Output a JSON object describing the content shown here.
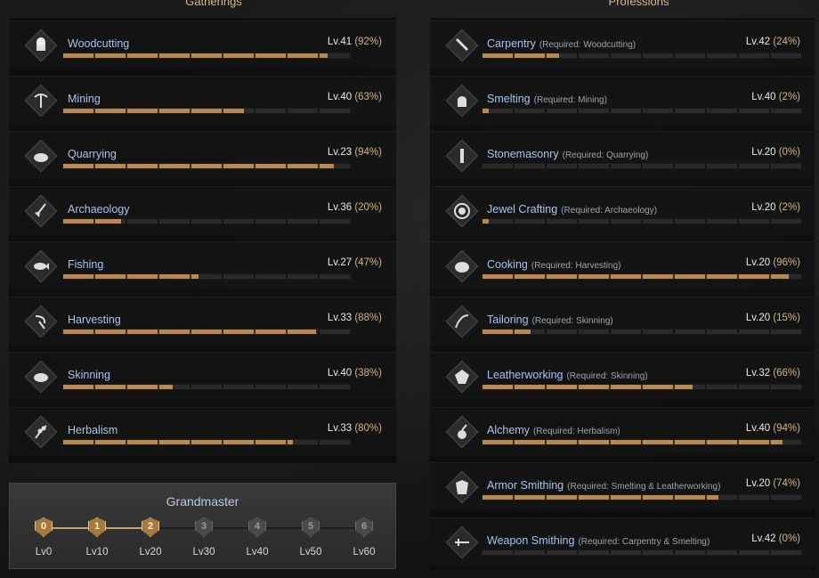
{
  "sections": {
    "gatherings_title": "Gatherings",
    "professions_title": "Professions"
  },
  "gatherings": [
    {
      "name": "Woodcutting",
      "level": "Lv.41",
      "percent": "(92%)",
      "progress": 0.92,
      "icon": "log-icon"
    },
    {
      "name": "Mining",
      "level": "Lv.40",
      "percent": "(63%)",
      "progress": 0.63,
      "icon": "pickaxe-icon"
    },
    {
      "name": "Quarrying",
      "level": "Lv.23",
      "percent": "(94%)",
      "progress": 0.94,
      "icon": "stone-icon"
    },
    {
      "name": "Archaeology",
      "level": "Lv.36",
      "percent": "(20%)",
      "progress": 0.2,
      "icon": "shovel-icon"
    },
    {
      "name": "Fishing",
      "level": "Lv.27",
      "percent": "(47%)",
      "progress": 0.47,
      "icon": "fish-icon"
    },
    {
      "name": "Harvesting",
      "level": "Lv.33",
      "percent": "(88%)",
      "progress": 0.88,
      "icon": "sickle-icon"
    },
    {
      "name": "Skinning",
      "level": "Lv.40",
      "percent": "(38%)",
      "progress": 0.38,
      "icon": "boar-icon"
    },
    {
      "name": "Herbalism",
      "level": "Lv.33",
      "percent": "(80%)",
      "progress": 0.8,
      "icon": "herb-icon"
    }
  ],
  "professions": [
    {
      "name": "Carpentry",
      "required": "(Required: Woodcutting)",
      "level": "Lv.42",
      "percent": "(24%)",
      "progress": 0.24,
      "icon": "saw-icon"
    },
    {
      "name": "Smelting",
      "required": "(Required: Mining)",
      "level": "Lv.40",
      "percent": "(2%)",
      "progress": 0.02,
      "icon": "furnace-icon"
    },
    {
      "name": "Stonemasonry",
      "required": "(Required: Quarrying)",
      "level": "Lv.20",
      "percent": "(0%)",
      "progress": 0.0,
      "icon": "chisel-icon"
    },
    {
      "name": "Jewel Crafting",
      "required": "(Required: Archaeology)",
      "level": "Lv.20",
      "percent": "(2%)",
      "progress": 0.02,
      "icon": "gem-icon"
    },
    {
      "name": "Cooking",
      "required": "(Required: Harvesting)",
      "level": "Lv.20",
      "percent": "(96%)",
      "progress": 0.96,
      "icon": "pot-icon"
    },
    {
      "name": "Tailoring",
      "required": "(Required: Skinning)",
      "level": "Lv.20",
      "percent": "(15%)",
      "progress": 0.15,
      "icon": "needle-icon"
    },
    {
      "name": "Leatherworking",
      "required": "(Required: Skinning)",
      "level": "Lv.32",
      "percent": "(66%)",
      "progress": 0.66,
      "icon": "hide-icon"
    },
    {
      "name": "Alchemy",
      "required": "(Required: Herbalism)",
      "level": "Lv.40",
      "percent": "(94%)",
      "progress": 0.94,
      "icon": "flask-icon"
    },
    {
      "name": "Armor Smithing",
      "required": "(Required: Smelting & Leatherworking)",
      "level": "Lv.20",
      "percent": "(74%)",
      "progress": 0.74,
      "icon": "armor-icon"
    },
    {
      "name": "Weapon Smithing",
      "required": "(Required: Carpentry & Smelting)",
      "level": "Lv.42",
      "percent": "(0%)",
      "progress": 0.0,
      "icon": "sword-icon"
    }
  ],
  "grandmaster": {
    "title": "Grandmaster",
    "tiers": [
      {
        "num": "0",
        "label": "Lv0",
        "active": true
      },
      {
        "num": "1",
        "label": "Lv10",
        "active": true
      },
      {
        "num": "2",
        "label": "Lv20",
        "active": true
      },
      {
        "num": "3",
        "label": "Lv30",
        "active": false
      },
      {
        "num": "4",
        "label": "Lv40",
        "active": false
      },
      {
        "num": "5",
        "label": "Lv50",
        "active": false
      },
      {
        "num": "6",
        "label": "Lv60",
        "active": false
      }
    ]
  },
  "colors": {
    "name_blue": "#a9c4ea",
    "percent_gold": "#d8b27a",
    "bar_fill": "#b48a58"
  }
}
